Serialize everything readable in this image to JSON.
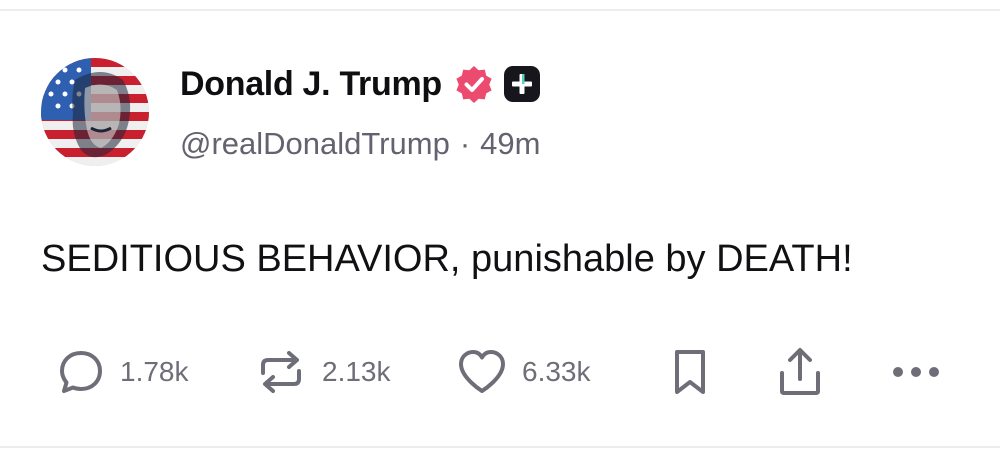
{
  "post": {
    "author": {
      "display_name": "Donald J. Trump",
      "handle": "@realDonaldTrump",
      "time_separator": "·",
      "time_ago": "49m",
      "verified_badge": "verified-check-icon",
      "extra_badge": "plus-icon"
    },
    "text": "SEDITIOUS BEHAVIOR, punishable by DEATH!",
    "actions": {
      "replies": "1.78k",
      "reposts": "2.13k",
      "likes": "6.33k"
    }
  },
  "colors": {
    "verified_badge": "#ec4a6e",
    "plus_badge_bg": "#16161c",
    "plus_badge_accent": "#5cd0c4",
    "muted_text": "#636370",
    "icon": "#6e6e78"
  }
}
